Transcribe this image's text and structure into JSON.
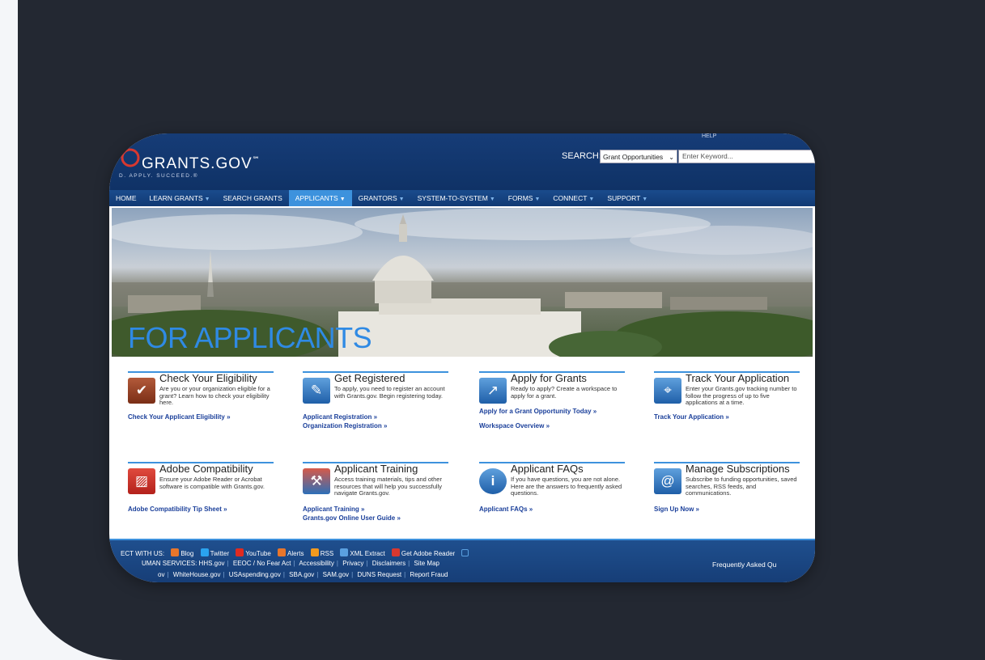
{
  "header": {
    "logo": "GRANTS.GOV",
    "logo_mark": "℠",
    "tagline": "D. APPLY. SUCCEED.®",
    "help": "HELP",
    "search_label": "SEARCH:",
    "search_scope": "Grant Opportunities",
    "search_placeholder": "Enter Keyword..."
  },
  "nav": {
    "items": [
      {
        "label": "HOME"
      },
      {
        "label": "LEARN GRANTS"
      },
      {
        "label": "SEARCH GRANTS"
      },
      {
        "label": "APPLICANTS"
      },
      {
        "label": "GRANTORS"
      },
      {
        "label": "SYSTEM-TO-SYSTEM"
      },
      {
        "label": "FORMS"
      },
      {
        "label": "CONNECT"
      },
      {
        "label": "SUPPORT"
      }
    ]
  },
  "hero": {
    "title": "FOR APPLICANTS"
  },
  "tiles": [
    {
      "title": "Check Your Eligibility",
      "desc": "Are you or your organization eligible for a grant? Learn how to check your eligibility here.",
      "link1": "Check Your Applicant Eligibility »",
      "link2": "",
      "icon": "checklist-icon",
      "glyph": "✔",
      "color": "#a33b1f"
    },
    {
      "title": "Get Registered",
      "desc": "To apply, you need to register an account with Grants.gov. Begin registering today.",
      "link1": "Applicant Registration »",
      "link2": "Organization Registration »",
      "icon": "register-icon",
      "glyph": "✎",
      "color": "#2d6fb8"
    },
    {
      "title": "Apply for Grants",
      "desc": "Ready to apply? Create a workspace to apply for a grant.",
      "link1": "Apply for a Grant Opportunity Today »",
      "link2": "Workspace Overview »",
      "icon": "apply-icon",
      "glyph": "↗",
      "color": "#3a86cf"
    },
    {
      "title": "Track Your Application",
      "desc": "Enter your Grants.gov tracking number to follow the progress of up to five applications at a time.",
      "link1": "Track Your Application »",
      "link2": "",
      "icon": "track-icon",
      "glyph": "⌖",
      "color": "#3a86cf"
    },
    {
      "title": "Adobe Compatibility",
      "desc": "Ensure your Adobe Reader or Acrobat software is compatible with Grants.gov.",
      "link1": "Adobe Compatibility Tip Sheet »",
      "link2": "",
      "icon": "adobe-icon",
      "glyph": "⌘",
      "color": "#c92b27"
    },
    {
      "title": "Applicant Training",
      "desc": "Access training materials, tips and other resources that will help you successfully navigate Grants.gov.",
      "link1": "Applicant Training »",
      "link2": "Grants.gov Online User Guide »",
      "icon": "training-icon",
      "glyph": "⚒",
      "color": "#c03a2b"
    },
    {
      "title": "Applicant FAQs",
      "desc": "If you have questions, you are not alone. Here are the answers to frequently asked questions.",
      "link1": "Applicant FAQs »",
      "link2": "",
      "icon": "info-icon",
      "glyph": "i",
      "color": "#1f5fa8"
    },
    {
      "title": "Manage Subscriptions",
      "desc": "Subscribe to funding opportunities, saved searches, RSS feeds, and communications.",
      "link1": "Sign Up Now »",
      "link2": "",
      "icon": "email-icon",
      "glyph": "@",
      "color": "#3a86cf"
    }
  ],
  "footer": {
    "connect_label": "ECT WITH US:",
    "social": [
      {
        "label": "Blog",
        "icon": "blog-icon",
        "color": "#e8762b"
      },
      {
        "label": "Twitter",
        "icon": "twitter-icon",
        "color": "#2aa3ef"
      },
      {
        "label": "YouTube",
        "icon": "youtube-icon",
        "color": "#e02b20"
      },
      {
        "label": "Alerts",
        "icon": "alerts-icon",
        "color": "#e8762b"
      },
      {
        "label": "RSS",
        "icon": "rss-icon",
        "color": "#f39a1e"
      },
      {
        "label": "XML Extract",
        "icon": "xml-icon",
        "color": "#5aa0e0"
      },
      {
        "label": "Get Adobe Reader",
        "icon": "adobe-reader-icon",
        "color": "#d8382f"
      }
    ],
    "line2_prefix": "UMAN SERVICES:",
    "line2_links": [
      "HHS.gov",
      "EEOC / No Fear Act",
      "Accessibility",
      "Privacy",
      "Disclaimers",
      "Site Map"
    ],
    "line3_prefix": "ov",
    "line3_links": [
      "WhiteHouse.gov",
      "USAspending.gov",
      "SBA.gov",
      "SAM.gov",
      "DUNS Request",
      "Report Fraud"
    ],
    "faq_link": "Frequently Asked Qu"
  }
}
